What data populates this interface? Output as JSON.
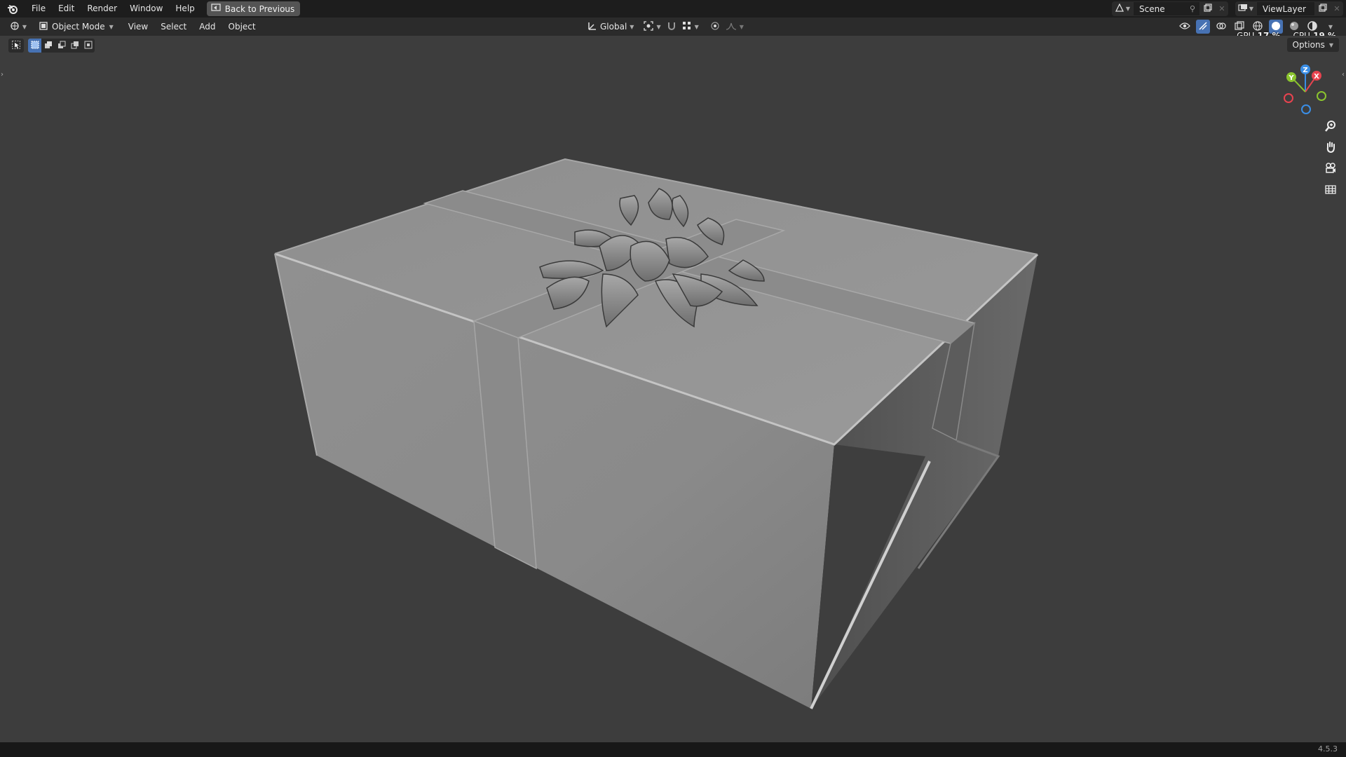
{
  "menu": {
    "items": [
      "File",
      "Edit",
      "Render",
      "Window",
      "Help"
    ],
    "back_button": "Back to Previous"
  },
  "scene": {
    "name": "Scene",
    "view_layer": "ViewLayer"
  },
  "header": {
    "mode": "Object Mode",
    "menus": [
      "View",
      "Select",
      "Add",
      "Object"
    ],
    "transform_orientation": "Global",
    "options_label": "Options"
  },
  "stats": {
    "gpu_label": "GPU",
    "gpu_value": "17 %",
    "cpu_label": "CPU",
    "cpu_value": "19 %"
  },
  "gizmo": {
    "x": "X",
    "y": "Y",
    "z": "Z"
  },
  "status": {
    "version": "4.5.3"
  },
  "colors": {
    "accent": "#4772b3",
    "axis_x": "#e8434f",
    "axis_y": "#8bc42e",
    "axis_z": "#3a8ee6"
  }
}
